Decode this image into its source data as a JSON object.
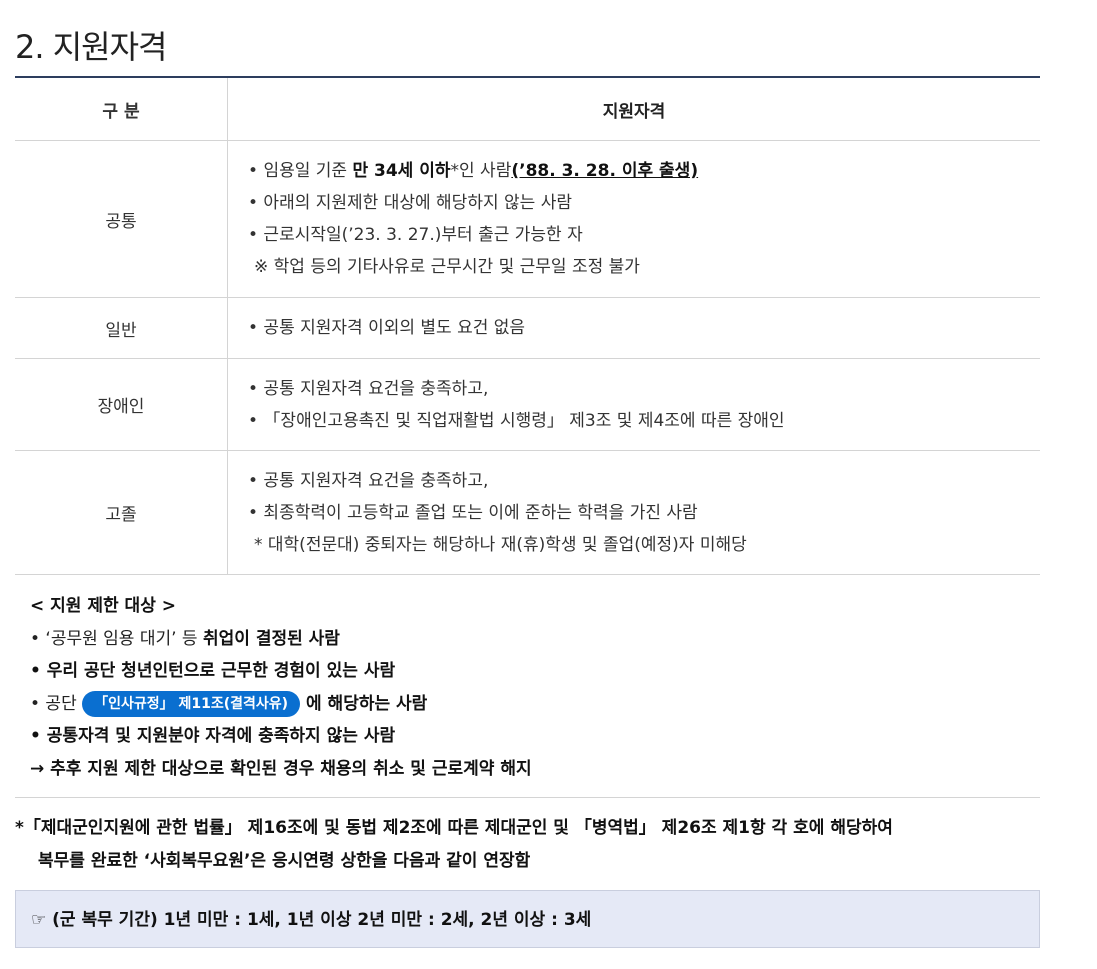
{
  "section": {
    "title": "2. 지원자격"
  },
  "table": {
    "headers": [
      "구 분",
      "지원자격"
    ],
    "rows": [
      {
        "category": "공통",
        "lines": [
          {
            "bullet": "• ",
            "pre": "임용일 기준 ",
            "bold": "만 34세 이하",
            "mid": "*인 사람",
            "bold_u": "(’88. 3. 28. 이후 출생)"
          },
          {
            "text": "• 아래의 지원제한 대상에 해당하지 않는 사람"
          },
          {
            "text": "• 근로시작일(’23. 3. 27.)부터 출근 가능한 자"
          },
          {
            "text": " ※ 학업 등의 기타사유로 근무시간 및 근무일 조정 불가"
          }
        ]
      },
      {
        "category": "일반",
        "lines": [
          {
            "text": "• 공통 지원자격 이외의 별도 요건 없음"
          }
        ]
      },
      {
        "category": "장애인",
        "lines": [
          {
            "text": "• 공통 지원자격 요건을 충족하고,"
          },
          {
            "text": "• 「장애인고용촉진 및 직업재활법 시행령」 제3조 및 제4조에 따른 장애인"
          }
        ]
      },
      {
        "category": "고졸",
        "lines": [
          {
            "text": "• 공통 지원자격 요건을 충족하고,"
          },
          {
            "text": "• 최종학력이 고등학교 졸업 또는 이에 준하는 학력을 가진 사람"
          },
          {
            "text": " * 대학(전문대) 중퇴자는 해당하나 재(휴)학생 및 졸업(예정)자 미해당"
          }
        ]
      }
    ]
  },
  "restrictions": {
    "heading": "< 지원 제한 대상 >",
    "item1_pre": " • ‘공무원 임용 대기’ 등 ",
    "item1_bold": "취업이 결정된 사람",
    "item2": " • 우리 공단 청년인턴으로 근무한 경험이 있는 사람",
    "item3_pre": " • 공단 ",
    "item3_pill": "「인사규정」 제11조(결격사유)",
    "item3_post": " 에 해당하는 사람",
    "item4": " • 공통자격 및 지원분야 자격에 충족하지 않는 사람",
    "item5": "→ 추후 지원 제한 대상으로 확인된 경우 채용의 취소 및 근로계약 해지",
    "pill_color": "#0a6fd0"
  },
  "law_note": {
    "line1": "*「제대군인지원에 관한 법률」 제16조에 및 동법 제2조에 따른 제대군인 및 「병역법」 제26조 제1항 각 호에 해당하여",
    "line2": "복무를 완료한 ‘사회복무요원’은 응시연령 상한을 다음과 같이 연장함"
  },
  "extension_box": {
    "text": "☞ (군 복무 기간) 1년 미만 : 1세, 1년 이상 2년 미만 : 2세, 2년 이상 : 3세",
    "background": "#e5e9f6"
  }
}
